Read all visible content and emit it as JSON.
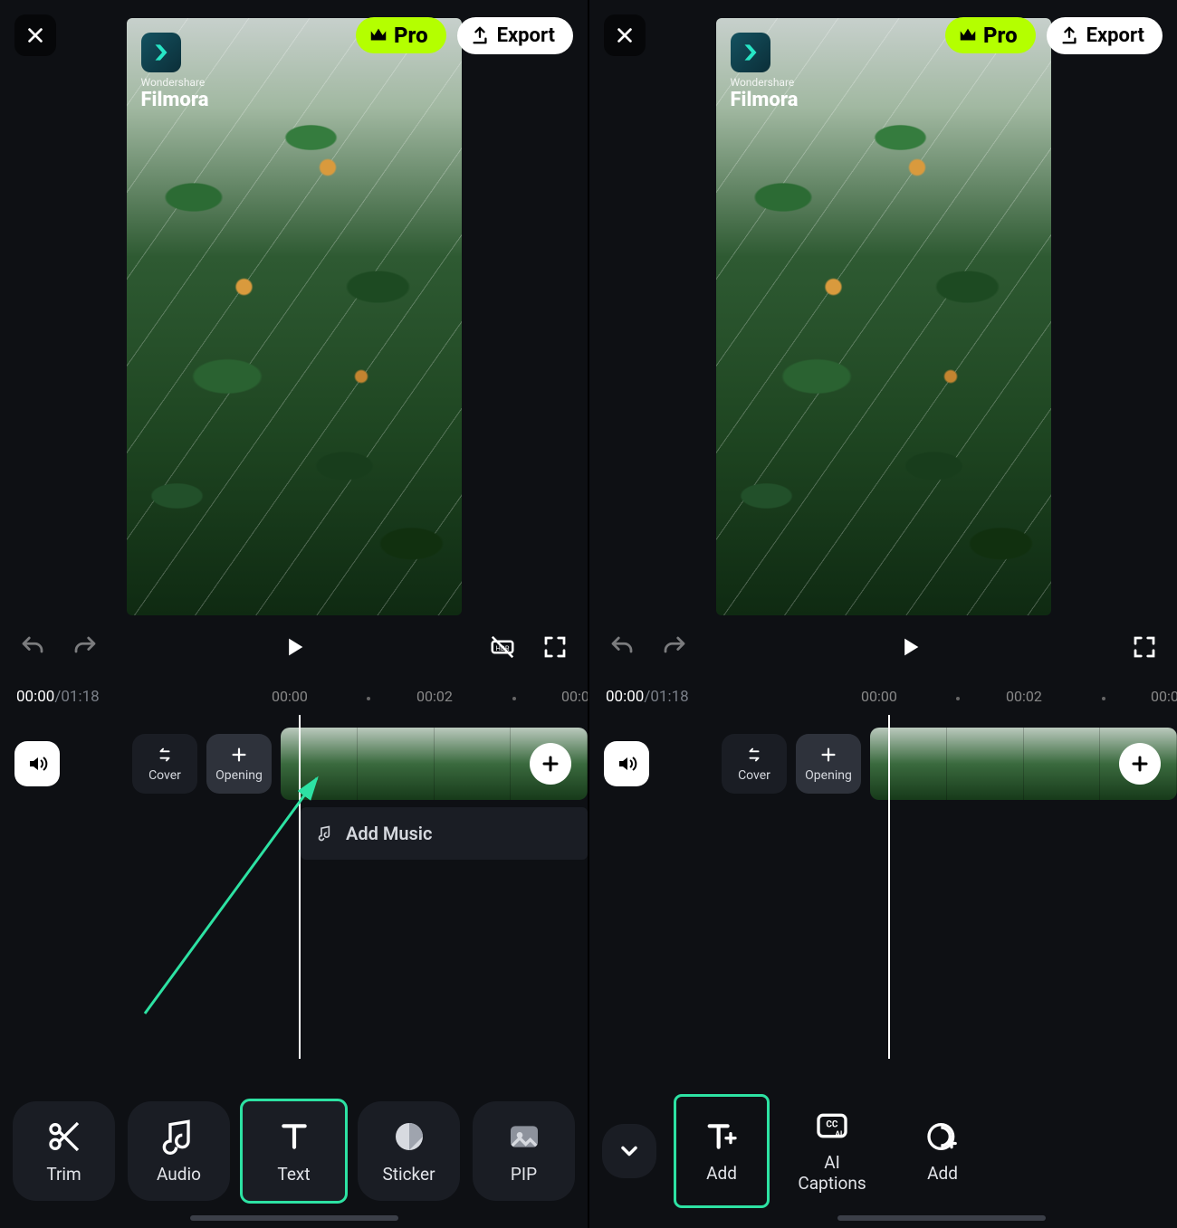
{
  "app": {
    "brand": "Wondershare",
    "name": "Filmora"
  },
  "header": {
    "pro_label": "Pro",
    "export_label": "Export"
  },
  "transport": {
    "left": {
      "position": "00:00",
      "separator": "/",
      "duration": "01:18"
    },
    "right": {
      "position": "00:00",
      "separator": "/",
      "duration": "01:18"
    },
    "ruler_left": {
      "t0": "00:00",
      "t1": "00:02",
      "t2": "00:0"
    },
    "ruler_right": {
      "t0": "00:00",
      "t1": "00:02",
      "t2": "00:0"
    }
  },
  "timeline": {
    "cover_label": "Cover",
    "opening_label": "Opening",
    "add_music_label": "Add Music"
  },
  "tools_left": [
    {
      "id": "trim",
      "label": "Trim"
    },
    {
      "id": "audio",
      "label": "Audio"
    },
    {
      "id": "text",
      "label": "Text",
      "highlight": true
    },
    {
      "id": "sticker",
      "label": "Sticker"
    },
    {
      "id": "pip",
      "label": "PIP"
    }
  ],
  "tools_right": [
    {
      "id": "add-text",
      "label": "Add",
      "highlight": true
    },
    {
      "id": "ai-captions",
      "label": "AI\nCaptions"
    },
    {
      "id": "add2",
      "label": "Add"
    }
  ],
  "colors": {
    "accent": "#2de2a3",
    "pro": "#b4ff00"
  }
}
